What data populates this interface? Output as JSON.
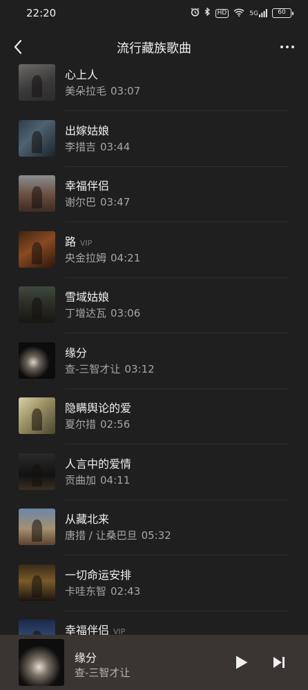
{
  "status_bar": {
    "time": "22:20",
    "icons": [
      "alarm-icon",
      "bluetooth-icon",
      "hd-icon",
      "wifi-icon",
      "5g-signal-icon",
      "battery-icon"
    ],
    "hd_label": "HD",
    "network_label": "5G",
    "battery": "60"
  },
  "header": {
    "title": "流行藏族歌曲"
  },
  "songs": [
    {
      "title": "心上人",
      "vip": "",
      "artist": "美朵拉毛",
      "duration": "03:07"
    },
    {
      "title": "出嫁姑娘",
      "vip": "",
      "artist": "李措吉",
      "duration": "03:44"
    },
    {
      "title": "幸福伴侣",
      "vip": "",
      "artist": "谢尔巴",
      "duration": "03:47"
    },
    {
      "title": "路",
      "vip": "VIP",
      "artist": "央金拉姆",
      "duration": "04:21"
    },
    {
      "title": "雪域姑娘",
      "vip": "",
      "artist": "丁增达瓦",
      "duration": "03:06"
    },
    {
      "title": "缘分",
      "vip": "",
      "artist": "查-三智才让",
      "duration": "03:12"
    },
    {
      "title": "隐瞒舆论的爱",
      "vip": "",
      "artist": "夏尔措",
      "duration": "02:56"
    },
    {
      "title": "人言中的爱情",
      "vip": "",
      "artist": "贡曲加",
      "duration": "04:11"
    },
    {
      "title": "从藏北来",
      "vip": "",
      "artist": "唐措 / 让桑巴旦",
      "duration": "05:32"
    },
    {
      "title": "一切命运安排",
      "vip": "",
      "artist": "卡哇东智",
      "duration": "02:43"
    },
    {
      "title": "幸福伴侣",
      "vip": "VIP",
      "artist": "",
      "duration": ""
    }
  ],
  "player": {
    "title": "缘分",
    "artist": "查-三智才让"
  },
  "colors": {
    "background": "#1f1f1f",
    "player_background": "#3a3533",
    "secondary_text": "#a6a6a6"
  }
}
